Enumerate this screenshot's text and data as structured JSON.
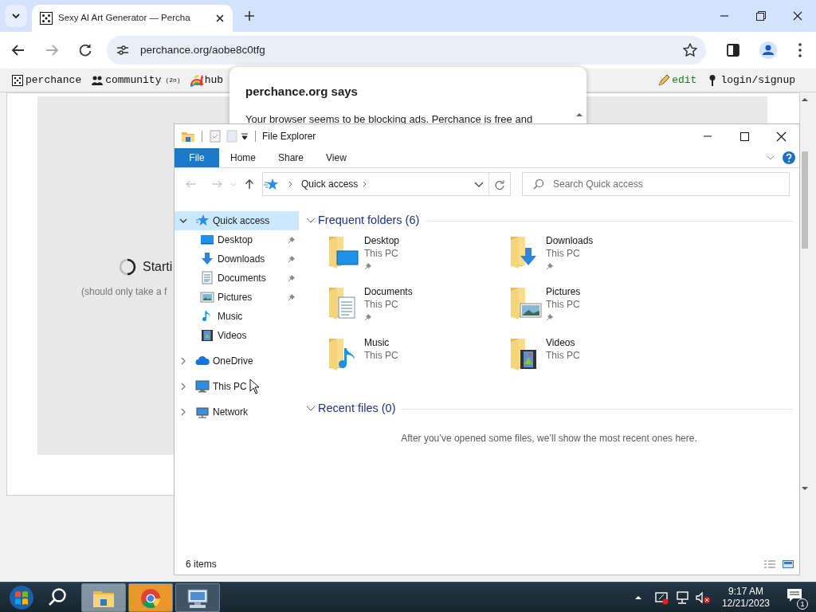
{
  "browser": {
    "tab": {
      "title": "Sexy AI Art Generator — Percha",
      "selected": true
    },
    "url": "perchance.org/aobe8c0tfg",
    "site_nav": {
      "left": [
        {
          "kind": "dice",
          "label": "perchance"
        },
        {
          "kind": "people",
          "label": "community",
          "badge": "(2n)"
        },
        {
          "kind": "rainbow",
          "label": "hub"
        }
      ],
      "right": [
        {
          "kind": "pencil",
          "label": "edit"
        },
        {
          "kind": "key",
          "label": "login/signup"
        }
      ]
    },
    "page": {
      "loading_text": "Starti",
      "loading_note": "(should only take a f"
    }
  },
  "dialog": {
    "title": "perchance.org says",
    "message": "Your browser seems to be blocking ads. Perchance is free and"
  },
  "explorer": {
    "title": "File Explorer",
    "ribbon_tabs": [
      {
        "label": "File",
        "selected": true
      },
      {
        "label": "Home",
        "selected": false
      },
      {
        "label": "Share",
        "selected": false
      },
      {
        "label": "View",
        "selected": false
      }
    ],
    "breadcrumb": "Quick access",
    "search": {
      "placeholder": "Search Quick access"
    },
    "nav": [
      {
        "kind": "star",
        "label": "Quick access",
        "expanded": true,
        "selected": true,
        "children": [
          {
            "kind": "desktop",
            "label": "Desktop",
            "pinned": true,
            "selected": false
          },
          {
            "kind": "downloads",
            "label": "Downloads",
            "pinned": true,
            "selected": false
          },
          {
            "kind": "documents",
            "label": "Documents",
            "pinned": true,
            "selected": false
          },
          {
            "kind": "pictures",
            "label": "Pictures",
            "pinned": true,
            "selected": false
          },
          {
            "kind": "music",
            "label": "Music",
            "pinned": false,
            "selected": false
          },
          {
            "kind": "videos",
            "label": "Videos",
            "pinned": false,
            "selected": false
          }
        ]
      },
      {
        "kind": "cloud",
        "label": "OneDrive",
        "expanded": false,
        "selected": false
      },
      {
        "kind": "pc",
        "label": "This PC",
        "expanded": false,
        "selected": false
      },
      {
        "kind": "network",
        "label": "Network",
        "expanded": false,
        "selected": false
      }
    ],
    "sections": [
      {
        "title": "Frequent folders (6)",
        "expanded": true,
        "items": [
          {
            "kind": "desktop",
            "name": "Desktop",
            "location": "This PC",
            "pinned": true
          },
          {
            "kind": "downloads",
            "name": "Downloads",
            "location": "This PC",
            "pinned": true
          },
          {
            "kind": "documents",
            "name": "Documents",
            "location": "This PC",
            "pinned": true
          },
          {
            "kind": "pictures",
            "name": "Pictures",
            "location": "This PC",
            "pinned": true
          },
          {
            "kind": "music",
            "name": "Music",
            "location": "This PC",
            "pinned": false
          },
          {
            "kind": "videos",
            "name": "Videos",
            "location": "This PC",
            "pinned": false
          }
        ]
      },
      {
        "title": "Recent files (0)",
        "expanded": true,
        "message": "After you’ve opened some files, we’ll show the most recent ones here."
      }
    ],
    "status": "6 items"
  },
  "taskbar": {
    "apps": [
      {
        "kind": "explorer"
      },
      {
        "kind": "chrome"
      },
      {
        "kind": "remote"
      }
    ],
    "time": "9:17 AM",
    "date": "12/21/2023",
    "notifications": "1"
  }
}
